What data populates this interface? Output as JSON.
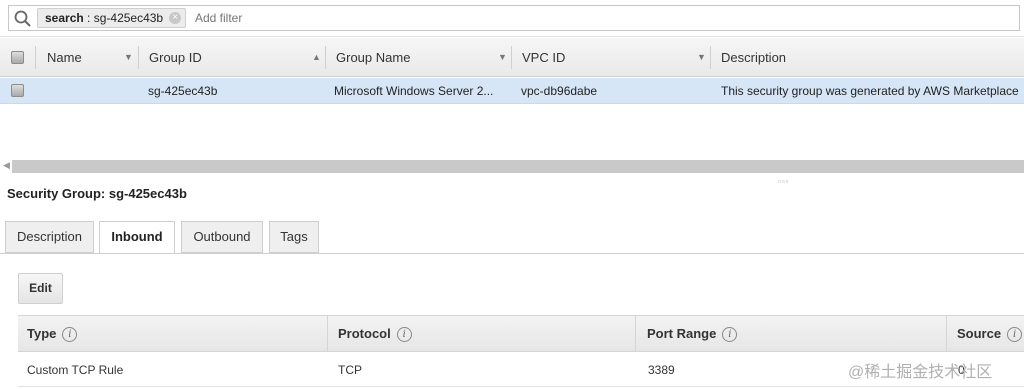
{
  "search": {
    "chip_key": "search",
    "chip_separator": " : ",
    "chip_value": "sg-425ec43b",
    "chip_close_icon": "×",
    "placeholder": "Add filter"
  },
  "grid": {
    "columns": [
      "Name",
      "Group ID",
      "Group Name",
      "VPC ID",
      "Description"
    ],
    "rows": [
      {
        "name": "",
        "group_id": "sg-425ec43b",
        "group_name": "Microsoft Windows Server 2...",
        "vpc_id": "vpc-db96dabe",
        "description": "This security group was generated by AWS Marketplace"
      }
    ]
  },
  "detail": {
    "title": "Security Group: sg-425ec43b",
    "tabs": [
      {
        "label": "Description",
        "active": false
      },
      {
        "label": "Inbound",
        "active": true
      },
      {
        "label": "Outbound",
        "active": false
      },
      {
        "label": "Tags",
        "active": false
      }
    ],
    "edit_label": "Edit",
    "info_icon": "i",
    "rules_columns": [
      "Type",
      "Protocol",
      "Port Range",
      "Source"
    ],
    "rules_rows": [
      {
        "type": "Custom TCP Rule",
        "protocol": "TCP",
        "port_range": "3389",
        "source": "0"
      }
    ]
  },
  "watermark": "@稀土掘金技术社区",
  "colors": {
    "selected_row": "#d6e6f6",
    "header_bg": "#ececec"
  }
}
